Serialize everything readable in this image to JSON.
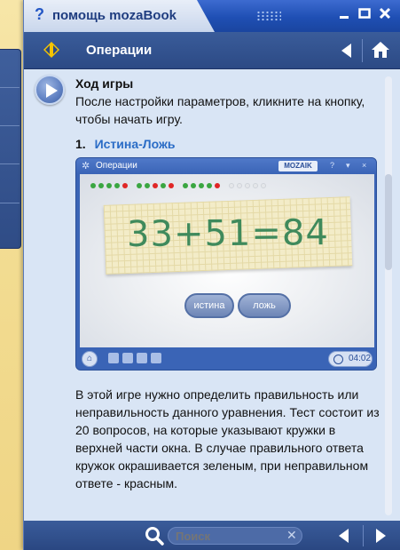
{
  "window": {
    "title_icon": "?",
    "title": "помощь mozaBook",
    "minimize_icon": "minimize-icon",
    "maximize_icon": "maximize-icon",
    "close_icon": "close-icon"
  },
  "header": {
    "title": "Операции",
    "nav_icon": "diamond-arrows-icon",
    "back_icon": "back-arrow-icon",
    "home_icon": "home-icon"
  },
  "content": {
    "play_icon": "play-icon",
    "heading": "Ход игры",
    "intro": "После настройки параметров, кликните на кнопку, чтобы начать игру.",
    "item_number": "1.",
    "item_title": "Истина-Ложь",
    "description": "В этой игре нужно определить правильность или неправильность данного уравнения. Тест состоит из 20 вопросов, на которые указывают кружки в верхней части окна. В случае правильного ответа кружок окрашивается зеленым, при неправильном ответе - красным."
  },
  "game_screenshot": {
    "title": "Операции",
    "logo": "MOZAIK",
    "controls": [
      "?",
      "▾",
      "×"
    ],
    "equation": "33+51=84",
    "true_button": "истина",
    "false_button": "ложь",
    "timer": "04:02",
    "progress_dots": [
      "green",
      "green",
      "green",
      "green",
      "red",
      "green",
      "green",
      "red",
      "green",
      "red",
      "green",
      "green",
      "green",
      "green",
      "red",
      "empty",
      "empty",
      "empty",
      "empty",
      "empty"
    ],
    "colors": {
      "green": "#3aa641",
      "red": "#e02626",
      "empty": "#e5e7ea"
    }
  },
  "footer": {
    "search_placeholder": "Поиск",
    "search_icon": "search-icon",
    "clear_icon": "clear-icon",
    "prev_icon": "prev-arrow-icon",
    "next_icon": "next-arrow-icon"
  },
  "colors": {
    "accent": "#2a6cc6",
    "bar": "#2c4a85",
    "content_bg": "#d9e5f5",
    "desk_bg": "#f3dd93"
  }
}
